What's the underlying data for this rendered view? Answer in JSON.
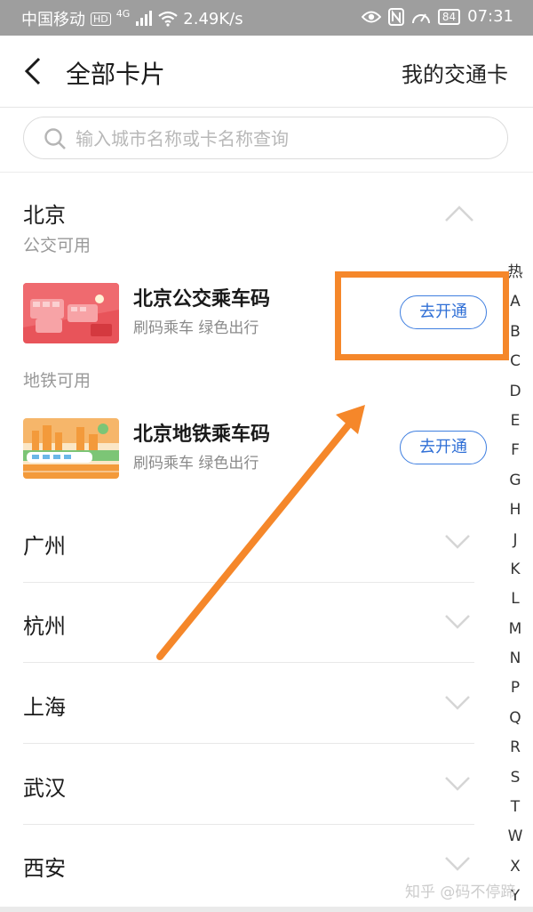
{
  "status_bar": {
    "carrier": "中国移动",
    "hd_badge": "HD",
    "signal": "4G",
    "speed": "2.49K/s",
    "battery": "84",
    "time": "07:31"
  },
  "header": {
    "title": "全部卡片",
    "right_link": "我的交通卡"
  },
  "search": {
    "placeholder": "输入城市名称或卡名称查询"
  },
  "expanded_city": {
    "name": "北京",
    "sections": [
      {
        "heading": "公交可用",
        "card": {
          "title": "北京公交乘车码",
          "subtitle": "刷码乘车 绿色出行",
          "button": "去开通"
        }
      },
      {
        "heading": "地铁可用",
        "card": {
          "title": "北京地铁乘车码",
          "subtitle": "刷码乘车 绿色出行",
          "button": "去开通"
        }
      }
    ]
  },
  "collapsed_cities": [
    "广州",
    "杭州",
    "上海",
    "武汉",
    "西安"
  ],
  "index_bar": [
    "热",
    "A",
    "B",
    "C",
    "D",
    "E",
    "F",
    "G",
    "H",
    "J",
    "K",
    "L",
    "M",
    "N",
    "P",
    "Q",
    "R",
    "S",
    "T",
    "W",
    "X",
    "Y"
  ],
  "watermark": "知乎 @码不停蹄",
  "colors": {
    "accent_blue": "#2f6fd6",
    "annotation_orange": "#f5872a",
    "status_bar_bg": "#9e9e9e"
  }
}
